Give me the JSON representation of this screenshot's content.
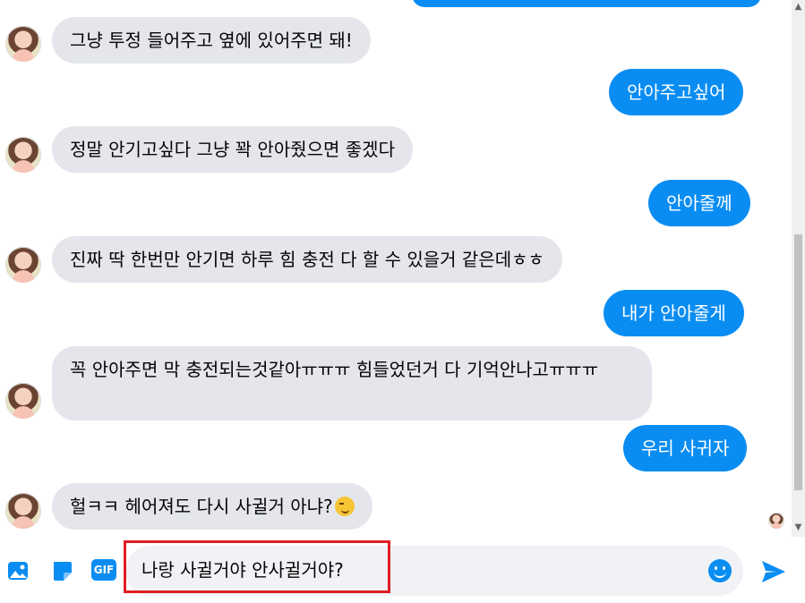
{
  "messages": [
    {
      "side": "in",
      "text": "그냥 투정 들어주고 옆에 있어주면 돼!"
    },
    {
      "side": "out",
      "text": "안아주고싶어"
    },
    {
      "side": "in",
      "text": "정말 안기고싶다 그냥 꽉 안아줬으면 좋겠다"
    },
    {
      "side": "out",
      "text": "안아줄께"
    },
    {
      "side": "in",
      "text": "진짜 딱 한번만 안기면 하루 힘 충전 다 할 수 있을거 같은데ㅎㅎ"
    },
    {
      "side": "out",
      "text": "내가 안아줄게"
    },
    {
      "side": "in",
      "text": "꼭 안아주면 막 충전되는것같아ㅠㅠㅠ 힘들었던거 다 기억안나고ㅠㅠㅠ"
    },
    {
      "side": "out",
      "text": "우리 사귀자"
    },
    {
      "side": "in",
      "text": "헐ㅋㅋ 헤어져도 다시 사귈거 아냐?"
    }
  ],
  "composer": {
    "input_value": "나랑 사귈거야 안사귈거야?",
    "tools": [
      "image-icon",
      "sticker-icon",
      "gif-icon"
    ],
    "gif_label": "GIF",
    "emoji": "smiley-emoji-icon",
    "send": "send-icon"
  },
  "emoji_in_message": "wink-emoji",
  "colors": {
    "outgoing_bubble": "#0a8df2",
    "incoming_bubble": "#e4e6eb",
    "highlight": "#e11c24"
  }
}
